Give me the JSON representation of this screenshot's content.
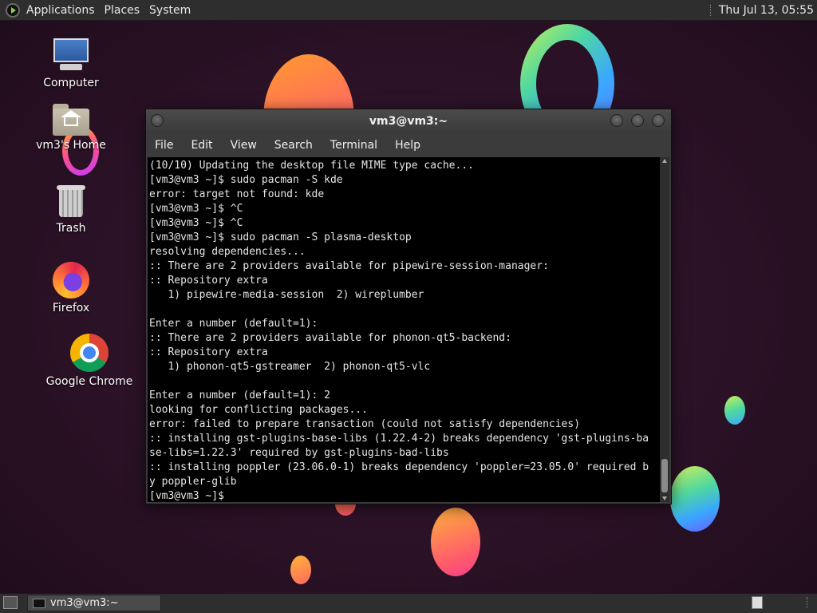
{
  "top_panel": {
    "menus": [
      "Applications",
      "Places",
      "System"
    ],
    "clock": "Thu Jul 13, 05:55"
  },
  "desktop_icons": [
    {
      "label": "Computer",
      "icon": "computer-icon"
    },
    {
      "label": "vm3's Home",
      "icon": "home-folder-icon"
    },
    {
      "label": "Trash",
      "icon": "trash-icon"
    },
    {
      "label": "Firefox",
      "icon": "firefox-icon"
    },
    {
      "label": "Google Chrome",
      "icon": "chrome-icon"
    }
  ],
  "terminal": {
    "title": "vm3@vm3:~",
    "menu": [
      "File",
      "Edit",
      "View",
      "Search",
      "Terminal",
      "Help"
    ],
    "lines": [
      "(10/10) Updating the desktop file MIME type cache...",
      "[vm3@vm3 ~]$ sudo pacman -S kde",
      "error: target not found: kde",
      "[vm3@vm3 ~]$ ^C",
      "[vm3@vm3 ~]$ ^C",
      "[vm3@vm3 ~]$ sudo pacman -S plasma-desktop",
      "resolving dependencies...",
      ":: There are 2 providers available for pipewire-session-manager:",
      ":: Repository extra",
      "   1) pipewire-media-session  2) wireplumber",
      "",
      "Enter a number (default=1):",
      ":: There are 2 providers available for phonon-qt5-backend:",
      ":: Repository extra",
      "   1) phonon-qt5-gstreamer  2) phonon-qt5-vlc",
      "",
      "Enter a number (default=1): 2",
      "looking for conflicting packages...",
      "error: failed to prepare transaction (could not satisfy dependencies)",
      ":: installing gst-plugins-base-libs (1.22.4-2) breaks dependency 'gst-plugins-ba",
      "se-libs=1.22.3' required by gst-plugins-bad-libs",
      ":: installing poppler (23.06.0-1) breaks dependency 'poppler=23.05.0' required b",
      "y poppler-glib",
      "[vm3@vm3 ~]$ "
    ]
  },
  "bottom_panel": {
    "task_label": "vm3@vm3:~"
  }
}
